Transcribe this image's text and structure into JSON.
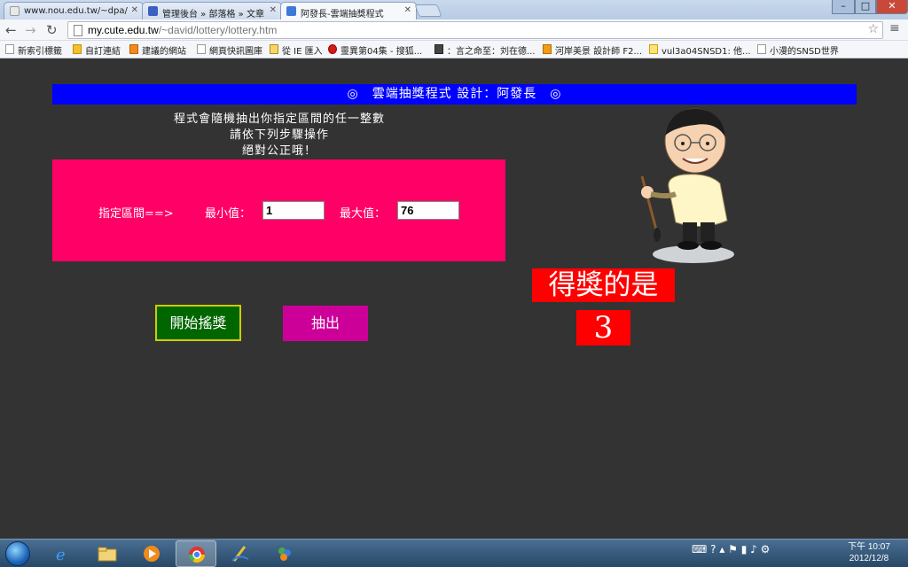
{
  "browser": {
    "tabs": [
      {
        "label": "www.nou.edu.tw/~dpa/"
      },
      {
        "label": "管理後台 » 部落格 » 文章"
      },
      {
        "label": "阿發長-雲端抽獎程式"
      }
    ],
    "url_host": "my.cute.edu.tw",
    "url_path": "/~david/lottery/lottery.htm",
    "bookmarks": [
      {
        "label": "新索引標籤"
      },
      {
        "label": "自訂連結"
      },
      {
        "label": "建議的網站"
      },
      {
        "label": "網頁快訊圖庫"
      },
      {
        "label": "從 IE 匯入"
      },
      {
        "label": "靈異第04集 - 搜狐..."
      },
      {
        "label": "：言之命至：刘在德..."
      },
      {
        "label": "河岸美景 設計師 F2..."
      },
      {
        "label": "vul3a04SNSD1: 他..."
      },
      {
        "label": "小漫的SNSD世界"
      }
    ]
  },
  "page": {
    "title": "◎　雲端抽獎程式 設計：阿發長　◎",
    "intro_line1": "程式會隨機抽出你指定區間的任一整數",
    "intro_line2": "請依下列步驟操作",
    "intro_line3": "絕對公正哦！",
    "range_label": "指定區間==>",
    "min_label": "最小值：",
    "min_value": "1",
    "max_label": "最大值：",
    "max_value": "76",
    "start_button": "開始搖獎",
    "draw_button": "抽出",
    "winner_label": "得獎的是",
    "winner_number": "3"
  },
  "taskbar": {
    "time": "下午 10:07",
    "date": "2012/12/8"
  },
  "colors": {
    "title_bar": "#0000ff",
    "panel": "#ff0066",
    "start_button": "#006600",
    "draw_button": "#cc0099",
    "winner": "#ff0000",
    "page_bg": "#333333"
  }
}
